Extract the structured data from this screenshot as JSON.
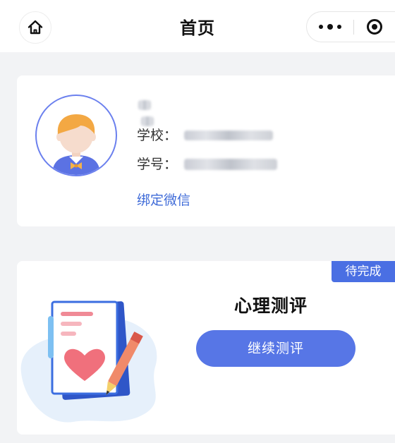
{
  "navbar": {
    "title": "首页",
    "home_icon": "home-icon",
    "more_icon": "more-dots-icon",
    "close_icon": "target-circle-icon"
  },
  "profile": {
    "name_blurred": true,
    "school_label": "学校：",
    "school_value_blurred": true,
    "student_id_label": "学号：",
    "student_id_value_blurred": true,
    "bind_wechat_link": "绑定微信",
    "avatar_icon": "child-avatar-icon",
    "accent_color": "#6b80ee"
  },
  "assessment": {
    "badge": "待完成",
    "title": "心理测评",
    "button_label": "继续测评",
    "illustration_icon": "document-heart-pen-illustration",
    "accent_color": "#5776e6"
  }
}
